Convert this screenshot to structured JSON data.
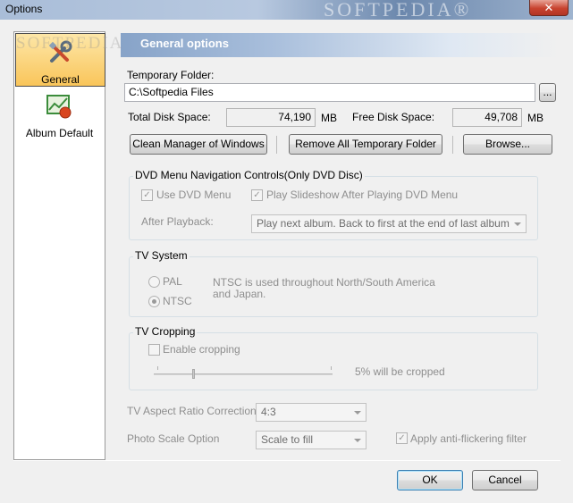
{
  "window": {
    "title": "Options",
    "close_glyph": "✕",
    "watermark": "SOFTPEDIA®"
  },
  "sidebar": {
    "items": [
      {
        "label": "General",
        "icon": "tools-icon",
        "selected": true
      },
      {
        "label": "Album Default",
        "icon": "album-chart-icon",
        "selected": false
      }
    ]
  },
  "header": {
    "title": "General options",
    "watermark": "SOFTPEDIA"
  },
  "temp": {
    "label": "Temporary Folder:",
    "path": "C:\\Softpedia Files",
    "browse_glyph": "...",
    "total_label": "Total Disk Space:",
    "total_value": "74,190",
    "total_unit": "MB",
    "free_label": "Free Disk Space:",
    "free_value": "49,708",
    "free_unit": "MB",
    "clean_button": "Clean Manager of Windows",
    "remove_button": "Remove All Temporary Folder",
    "browse_button": "Browse..."
  },
  "dvd": {
    "group_title": "DVD Menu Navigation Controls(Only DVD Disc)",
    "use_menu": "Use DVD Menu",
    "use_menu_checked": true,
    "play_slideshow": "Play Slideshow After Playing DVD Menu",
    "play_slideshow_checked": true,
    "after_label": "After Playback:",
    "after_value": "Play next album. Back to first at the end of last album"
  },
  "tv_system": {
    "group_title": "TV System",
    "pal": "PAL",
    "ntsc": "NTSC",
    "selected": "NTSC",
    "description": "NTSC is used throughout North/South America and Japan."
  },
  "tv_crop": {
    "group_title": "TV Cropping",
    "enable": "Enable cropping",
    "enable_checked": false,
    "percent_text": "5% will be cropped",
    "slider_value_percent": 5
  },
  "misc": {
    "aspect_label": "TV Aspect Ratio Correction",
    "aspect_value": "4:3",
    "photo_label": "Photo Scale Option",
    "photo_value": "Scale to fill",
    "antiflicker": "Apply anti-flickering filter",
    "antiflicker_checked": true
  },
  "footer": {
    "ok": "OK",
    "cancel": "Cancel"
  },
  "colors": {
    "selection_gradient_top": "#fde7a8",
    "selection_gradient_bottom": "#f9c55a",
    "header_band": "#87a3c8",
    "close_red": "#c8432f"
  }
}
